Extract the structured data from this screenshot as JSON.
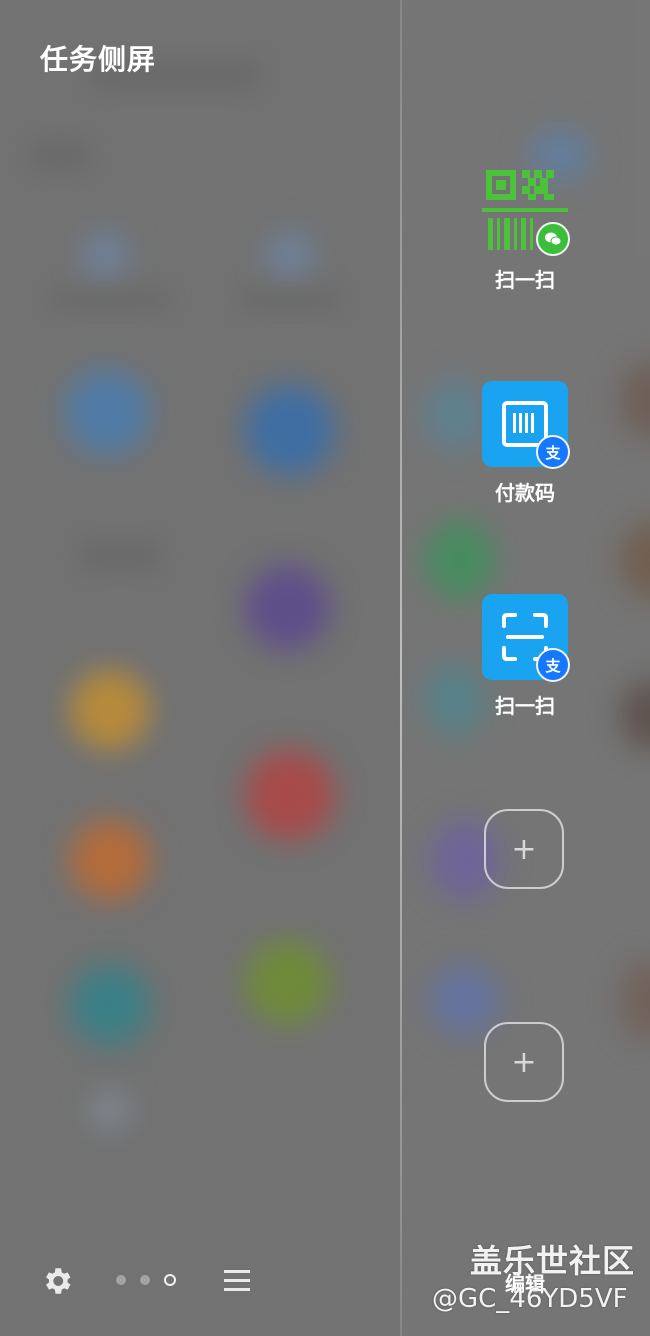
{
  "panel": {
    "title": "任务侧屏",
    "edit_label": "编辑"
  },
  "shortcuts": [
    {
      "label": "扫一扫",
      "app": "wechat",
      "icon": "qr-barcode-icon",
      "badge_icon": "wechat-icon",
      "color": "#4cc23a"
    },
    {
      "label": "付款码",
      "app": "alipay",
      "icon": "payment-code-icon",
      "badge_icon": "alipay-icon",
      "color": "#1aa3f0"
    },
    {
      "label": "扫一扫",
      "app": "alipay",
      "icon": "scan-frame-icon",
      "badge_icon": "alipay-icon",
      "color": "#1aa3f0"
    }
  ],
  "empty_slots": [
    {
      "icon": "plus-icon",
      "symbol": "+"
    },
    {
      "icon": "plus-icon",
      "symbol": "+"
    }
  ],
  "bottom_bar": {
    "settings_icon": "gear-icon",
    "menu_icon": "hamburger-menu-icon",
    "pages": 3,
    "active_page": 3
  },
  "watermark": {
    "line1": "盖乐世社区",
    "line2": "@GC_46YD5VF"
  },
  "colors": {
    "background": "#727272",
    "wechat_green": "#4cc23a",
    "alipay_blue": "#1aa3f0",
    "alipay_badge": "#1677ff"
  }
}
